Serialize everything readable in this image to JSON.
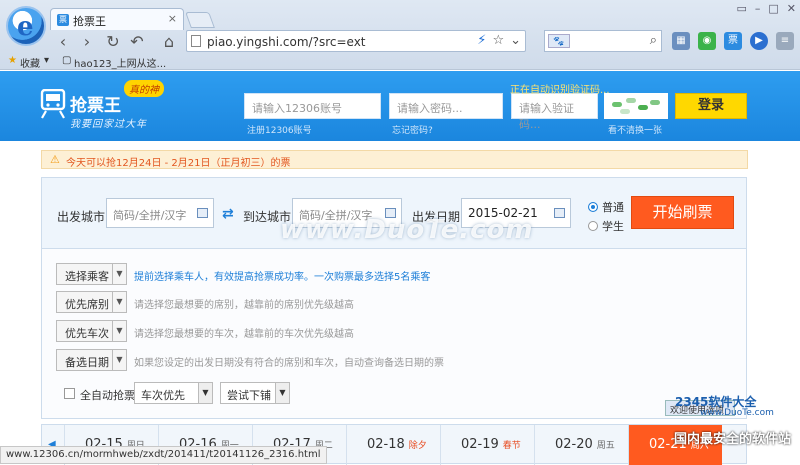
{
  "browser": {
    "tab_title": "抢票王",
    "tab_close": "×",
    "url": "piao.yingshi.com/?src=ext",
    "window_buttons": [
      "▭",
      "–",
      "□",
      "✕"
    ],
    "bookmarks": {
      "favorites": "收藏",
      "item1": "hao123_上网从这..."
    },
    "search_engine": "🐾"
  },
  "header": {
    "brand": "抢票王",
    "badge": "真的神",
    "slogan": "我要回家过大年",
    "username_placeholder": "请输入12306账号",
    "password_placeholder": "请输入密码...",
    "captcha_placeholder": "请输入验证码...",
    "captcha_status": "正在自动识别验证码...",
    "register_link": "注册12306账号",
    "forgot_link": "忘记密码?",
    "refresh_captcha": "看不清换一张",
    "login": "登录"
  },
  "notice": "今天可以抢12月24日 - 2月21日（正月初三）的票",
  "search": {
    "from_label": "出发城市",
    "from_placeholder": "简码/全拼/汉字",
    "to_label": "到达城市",
    "to_placeholder": "简码/全拼/汉字",
    "date_label": "出发日期",
    "date_value": "2015-02-21",
    "radio_normal": "普通",
    "radio_student": "学生",
    "start": "开始刷票"
  },
  "options": {
    "passenger": "选择乘客",
    "passenger_hint": "提前选择乘车人，有效提高抢票成功率。一次购票最多选择5名乘客",
    "seat": "优先席别",
    "seat_hint": "请选择您最想要的席别，越靠前的席别优先级越高",
    "train": "优先车次",
    "train_hint": "请选择您最想要的车次，越靠前的车次优先级越高",
    "backup": "备选日期",
    "backup_hint": "如果您设定的出发日期没有符合的席别和车次，自动查询备选日期的票",
    "auto_label": "全自动抢票",
    "sort_select": "车次优先",
    "berth_select": "尝试下铺"
  },
  "dates": [
    {
      "date": "02-15",
      "week": "周日",
      "holiday": false,
      "active": false
    },
    {
      "date": "02-16",
      "week": "周一",
      "holiday": false,
      "active": false
    },
    {
      "date": "02-17",
      "week": "周二",
      "holiday": false,
      "active": false
    },
    {
      "date": "02-18",
      "week": "除夕",
      "holiday": true,
      "active": false
    },
    {
      "date": "02-19",
      "week": "春节",
      "holiday": true,
      "active": false
    },
    {
      "date": "02-20",
      "week": "周五",
      "holiday": false,
      "active": false
    },
    {
      "date": "02-21",
      "week": "周六",
      "holiday": false,
      "active": true
    }
  ],
  "status_url": "www.12306.cn/mormhweb/zxdt/201411/t20141126_2316.html",
  "watermarks": {
    "center": "www.DuoTe.com",
    "corner_brand": "2345软件大全",
    "corner_url": "www.DuoTe.com",
    "corner_slogan": "国内最安全的软件站",
    "popup": "欢迎使用选项"
  },
  "colors": {
    "header_blue": "#1b86de",
    "action_orange": "#ff5a1f",
    "login_yellow": "#ffd800"
  }
}
